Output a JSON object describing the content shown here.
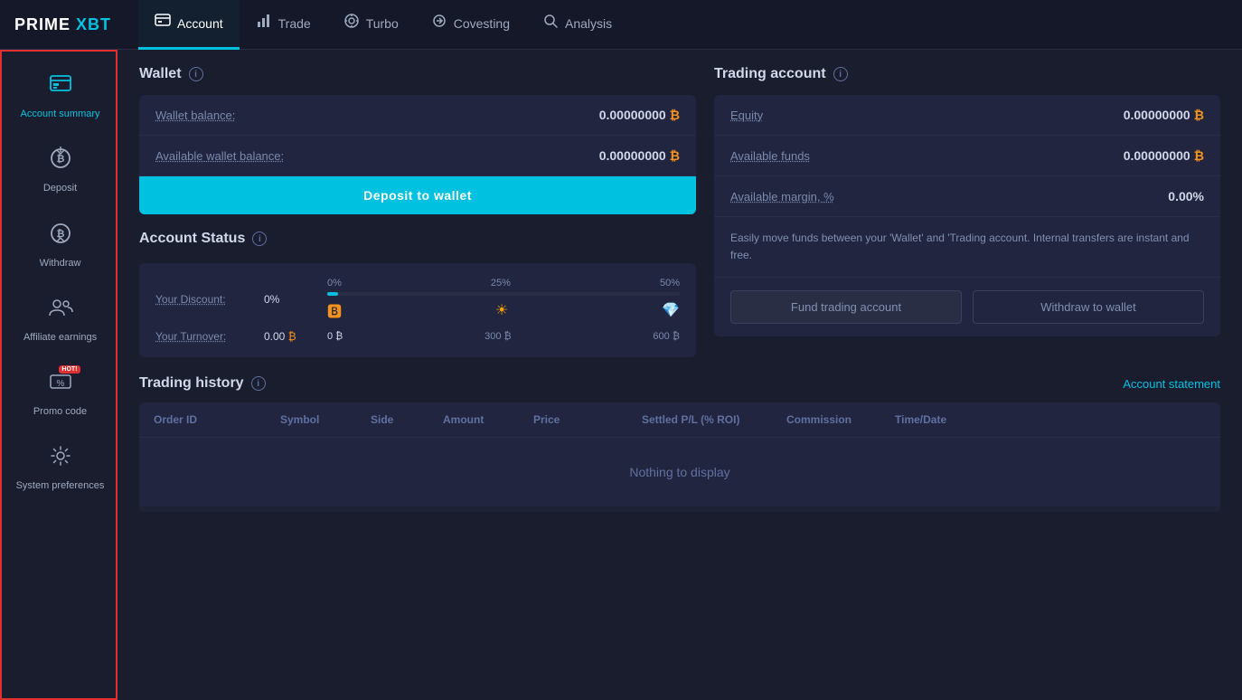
{
  "app": {
    "logo": "PRIME XBT"
  },
  "topnav": {
    "items": [
      {
        "id": "account",
        "label": "Account",
        "icon": "🗂",
        "active": true
      },
      {
        "id": "trade",
        "label": "Trade",
        "icon": "📊",
        "active": false
      },
      {
        "id": "turbo",
        "label": "Turbo",
        "icon": "⚡",
        "active": false
      },
      {
        "id": "covesting",
        "label": "Covesting",
        "icon": "🔄",
        "active": false
      },
      {
        "id": "analysis",
        "label": "Analysis",
        "icon": "📈",
        "active": false
      }
    ]
  },
  "sidebar": {
    "items": [
      {
        "id": "account-summary",
        "label": "Account summary",
        "icon": "📋",
        "active": true
      },
      {
        "id": "deposit",
        "label": "Deposit",
        "icon": "₿↑",
        "active": false
      },
      {
        "id": "withdraw",
        "label": "Withdraw",
        "icon": "₿↓",
        "active": false
      },
      {
        "id": "affiliate-earnings",
        "label": "Affiliate earnings",
        "icon": "👥",
        "active": false
      },
      {
        "id": "promo-code",
        "label": "Promo code",
        "icon": "🏷",
        "active": false,
        "badge": "HOT!"
      },
      {
        "id": "system-preferences",
        "label": "System preferences",
        "icon": "⚙",
        "active": false
      }
    ]
  },
  "wallet": {
    "section_title": "Wallet",
    "wallet_balance_label": "Wallet balance:",
    "wallet_balance_value": "0.00000000",
    "available_wallet_label": "Available wallet balance:",
    "available_wallet_value": "0.00000000",
    "deposit_btn": "Deposit to wallet",
    "btc_symbol": "₿"
  },
  "account_status": {
    "section_title": "Account Status",
    "discount_label": "Your Discount:",
    "discount_value": "0%",
    "turnover_label": "Your Turnover:",
    "turnover_value": "0.00",
    "progress": {
      "markers_pct": [
        "0%",
        "25%",
        "50%"
      ],
      "markers_btc": [
        "0 ₿",
        "300 ₿",
        "600 ₿"
      ],
      "current_pct": "0%",
      "fill_width": "3%"
    }
  },
  "trading_account": {
    "section_title": "Trading account",
    "equity_label": "Equity",
    "equity_value": "0.00000000",
    "available_funds_label": "Available funds",
    "available_funds_value": "0.00000000",
    "available_margin_label": "Available margin, %",
    "available_margin_value": "0.00%",
    "info_text": "Easily move funds between your 'Wallet' and 'Trading account. Internal transfers are instant and free.",
    "fund_btn": "Fund trading account",
    "withdraw_btn": "Withdraw to wallet",
    "btc_symbol": "₿"
  },
  "trading_history": {
    "section_title": "Trading history",
    "account_statement_label": "Account statement",
    "columns": [
      "Order ID",
      "Symbol",
      "Side",
      "Amount",
      "Price",
      "Settled P/L (% ROI)",
      "Commission",
      "Time/Date"
    ],
    "empty_message": "Nothing to display"
  }
}
